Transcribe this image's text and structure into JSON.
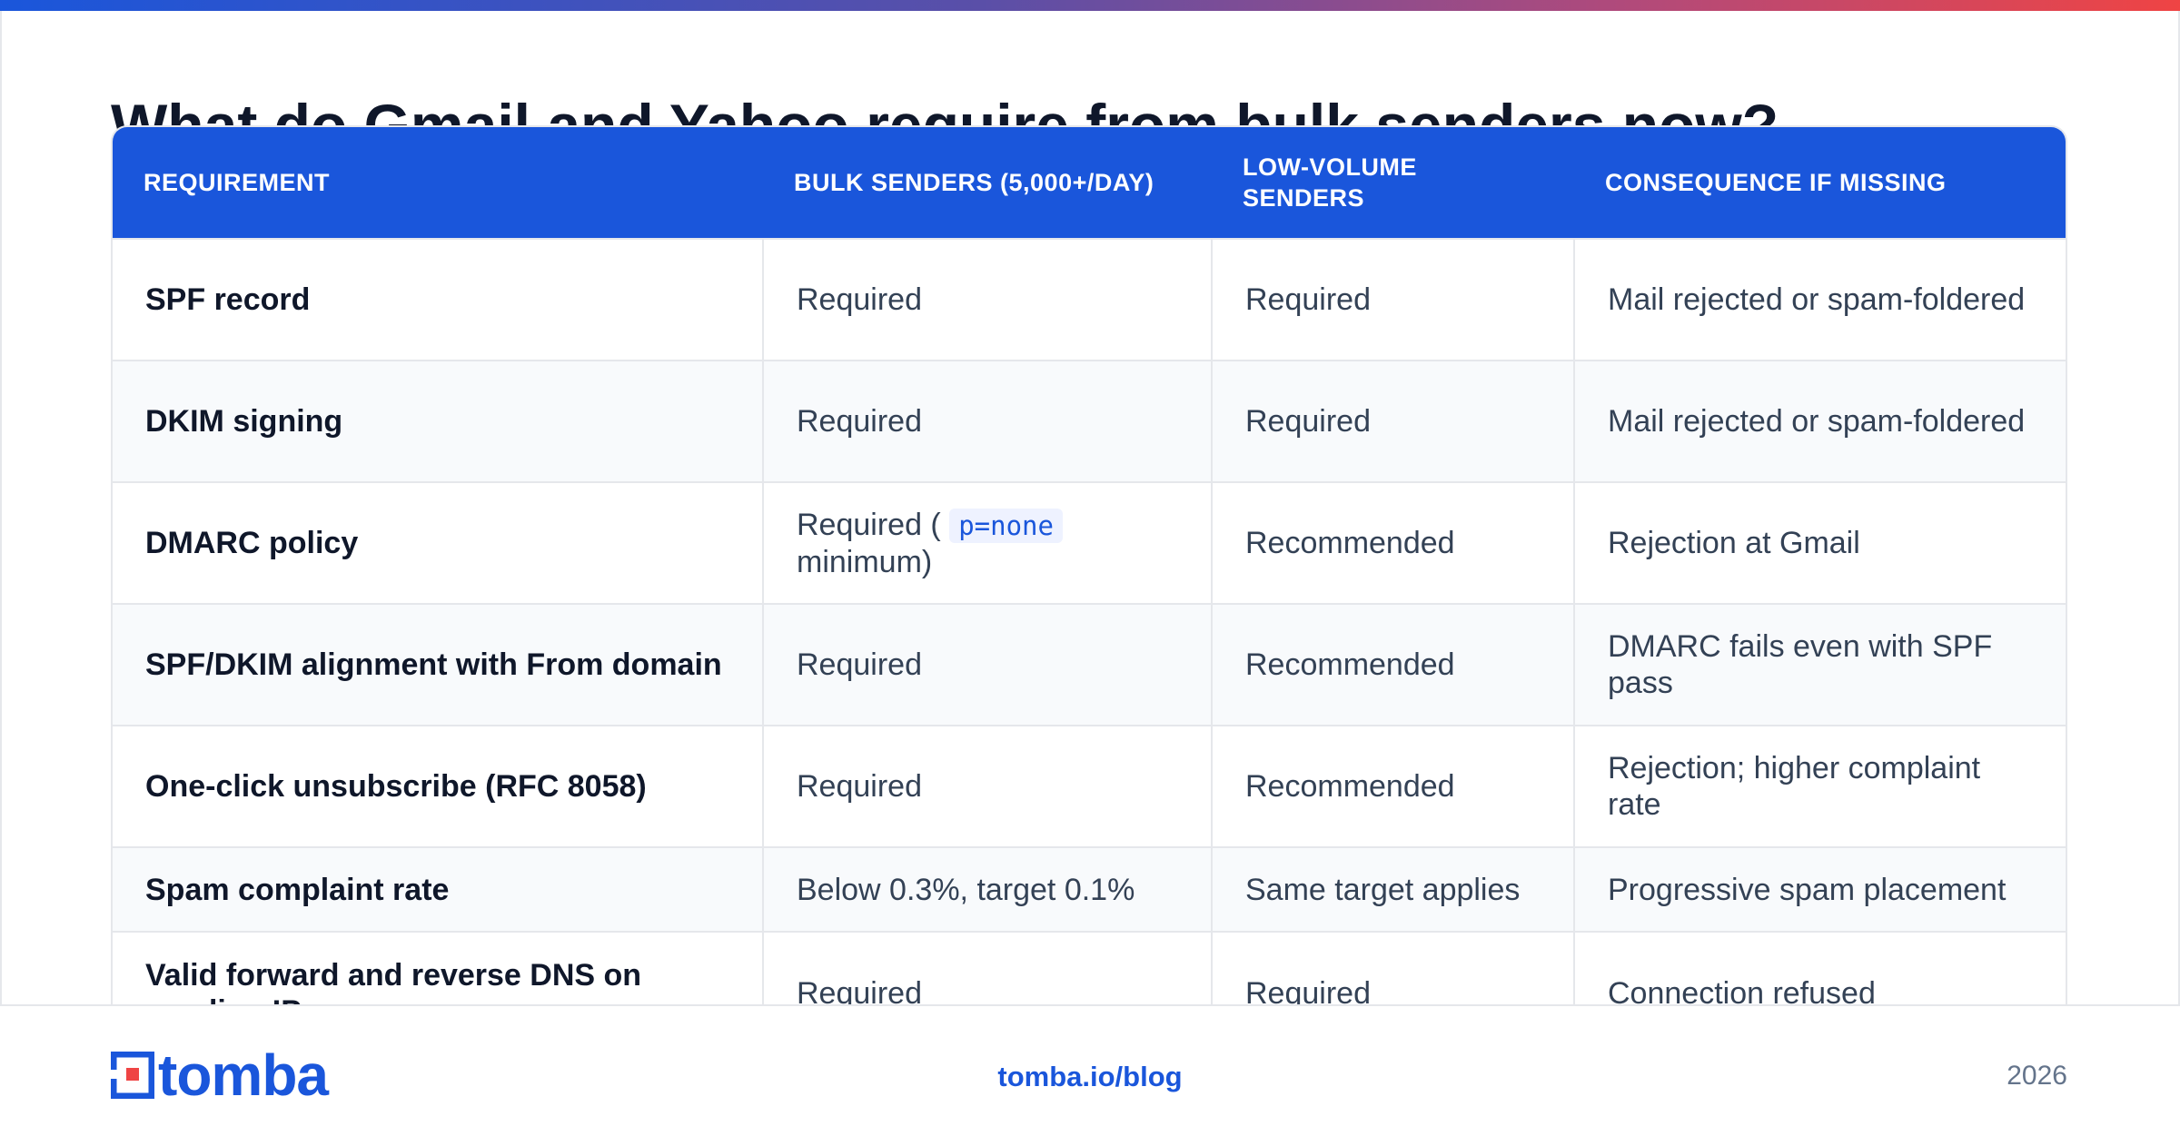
{
  "page": {
    "title": "What do Gmail and Yahoo require from bulk senders now?",
    "accent_colors": [
      "#1a56db",
      "#ef4444"
    ]
  },
  "table": {
    "headers": [
      "REQUIREMENT",
      "BULK SENDERS (5,000+/DAY)",
      "LOW-VOLUME SENDERS",
      "CONSEQUENCE IF MISSING"
    ],
    "rows": [
      {
        "requirement": "SPF record",
        "bulk": "Required",
        "low": "Required",
        "consequence": "Mail rejected or spam-foldered"
      },
      {
        "requirement": "DKIM signing",
        "bulk": "Required",
        "low": "Required",
        "consequence": "Mail rejected or spam-foldered"
      },
      {
        "requirement": "DMARC policy",
        "bulk_prefix": "Required (",
        "bulk_code": "p=none",
        "bulk_suffix": "minimum)",
        "low": "Recommended",
        "consequence": "Rejection at Gmail"
      },
      {
        "requirement": "SPF/DKIM alignment with From domain",
        "bulk": "Required",
        "low": "Recommended",
        "consequence": "DMARC fails even with SPF pass"
      },
      {
        "requirement": "One-click unsubscribe (RFC 8058)",
        "bulk": "Required",
        "low": "Recommended",
        "consequence": "Rejection; higher complaint rate"
      },
      {
        "requirement": "Spam complaint rate",
        "bulk": "Below 0.3%, target 0.1%",
        "low": "Same target applies",
        "consequence": "Progressive spam placement"
      },
      {
        "requirement": "Valid forward and reverse DNS on sending IP",
        "bulk": "Required",
        "low": "Required",
        "consequence": "Connection refused"
      }
    ]
  },
  "footer": {
    "brand": "tomba",
    "logo_icon": "tomba-logo-icon",
    "link": "tomba.io/blog",
    "year": "2026"
  }
}
